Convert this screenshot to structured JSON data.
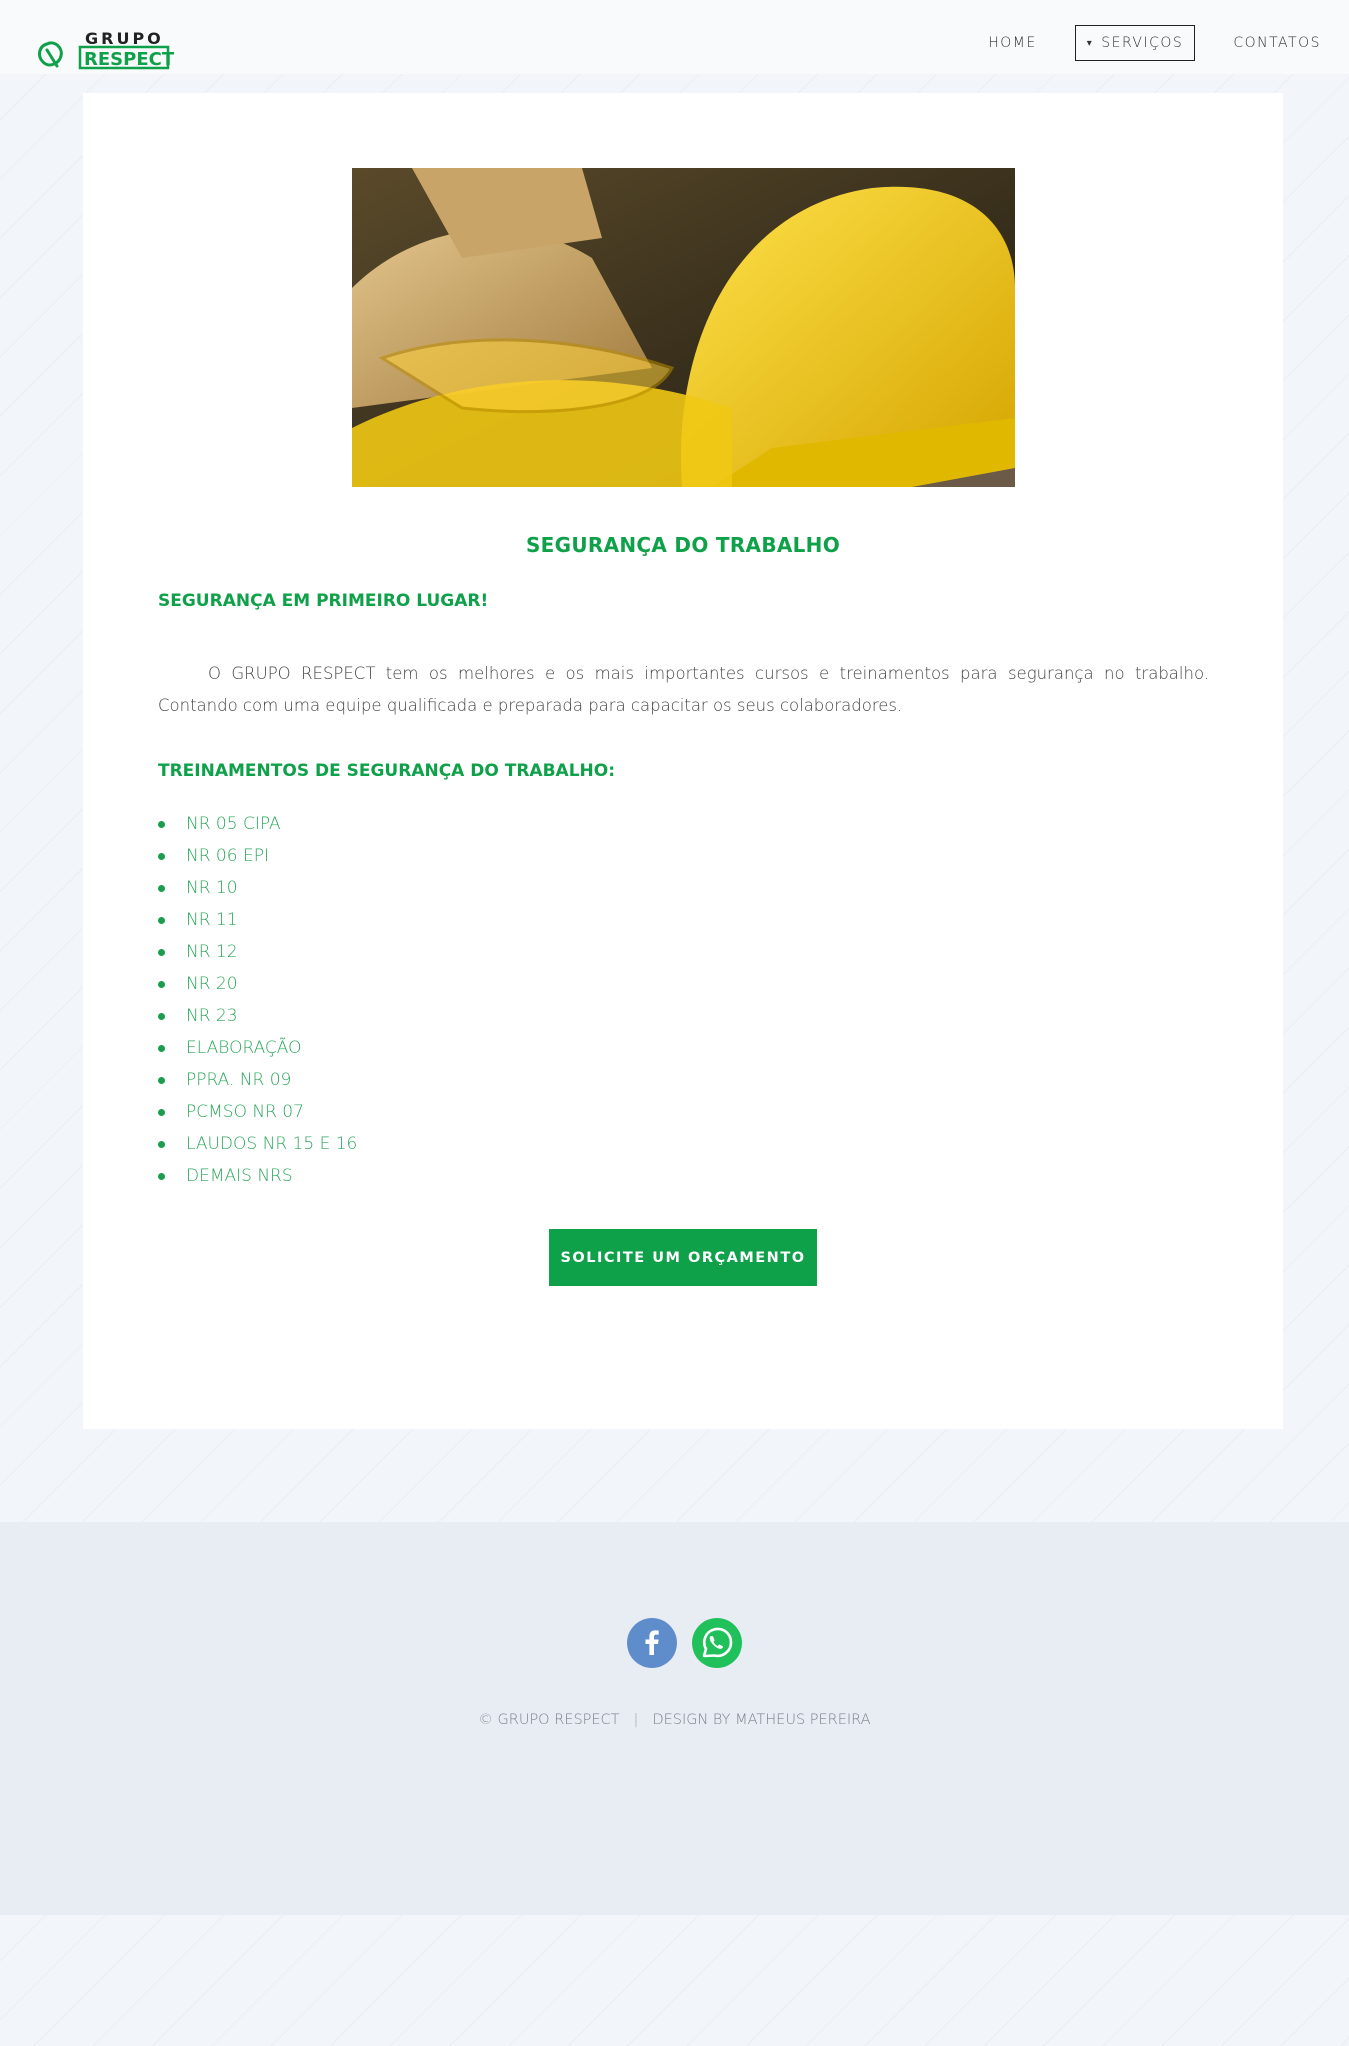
{
  "brand": {
    "logo_top": "GRUPO",
    "logo_bottom": "RESPECT",
    "color": "#0fa14a"
  },
  "nav": {
    "home": "HOME",
    "servicos": "SERVIÇOS",
    "contatos": "CONTATOS"
  },
  "main": {
    "title": "SEGURANÇA DO TRABALHO",
    "subtitle": "SEGURANÇA EM PRIMEIRO LUGAR!",
    "paragraph": "O GRUPO RESPECT tem os melhores e os mais importantes cursos e treinamentos para segurança no trabalho. Contando com uma equipe qualificada e preparada para capacitar os seus colaboradores.",
    "list_title": "TREINAMENTOS DE SEGURANÇA DO TRABALHO:",
    "items": [
      "NR 05 CIPA",
      "NR 06 EPI",
      "NR 10",
      "NR 11",
      "NR 12",
      "NR 20",
      "NR 23",
      "ELABORAÇÃO",
      "PPRA. NR 09",
      "PCMSO NR 07",
      "LAUDOS NR 15 E 16",
      "DEMAIS NRS"
    ],
    "cta": "SOLICITE UM ORÇAMENTO"
  },
  "footer": {
    "copyright": "© GRUPO RESPECT",
    "credit": "DESIGN BY MATHEUS PEREIRA",
    "social": [
      "facebook-icon",
      "whatsapp-icon"
    ],
    "facebook_color": "#5f8dcb",
    "whatsapp_color": "#20c05b"
  }
}
